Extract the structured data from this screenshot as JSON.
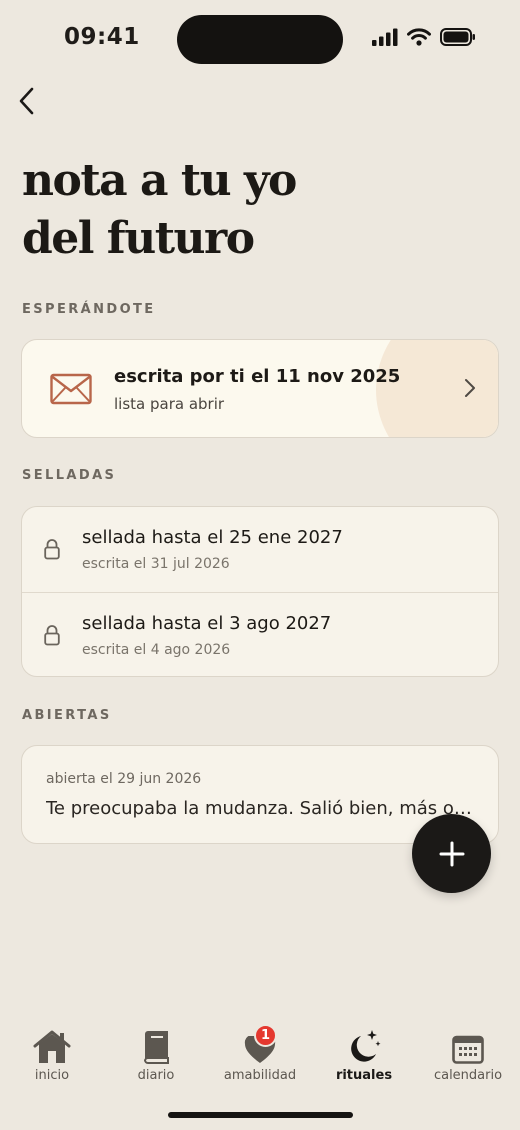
{
  "status_bar": {
    "time": "09:41"
  },
  "page": {
    "title_line1": "nota a tu yo",
    "title_line2": "del futuro"
  },
  "sections": {
    "waiting": {
      "label": "ESPERÁNDOTE",
      "card": {
        "title": "escrita por ti el 11 nov 2025",
        "subtitle": "lista para abrir"
      }
    },
    "sealed": {
      "label": "SELLADAS",
      "items": [
        {
          "title": "sellada hasta el 25 ene 2027",
          "subtitle": "escrita el 31 jul 2026"
        },
        {
          "title": "sellada hasta el 3 ago 2027",
          "subtitle": "escrita el 4 ago 2026"
        }
      ]
    },
    "opened": {
      "label": "ABIERTAS",
      "items": [
        {
          "date": "abierta el 29 jun 2026",
          "text": "Te preocupaba la mudanza. Salió bien, más o menos como esperabas."
        }
      ]
    }
  },
  "tabbar": {
    "items": [
      {
        "label": "inicio",
        "icon": "house-icon"
      },
      {
        "label": "diario",
        "icon": "book-icon"
      },
      {
        "label": "amabilidad",
        "icon": "heart-icon",
        "badge": "1"
      },
      {
        "label": "rituales",
        "icon": "moon-stars-icon",
        "active": true
      },
      {
        "label": "calendario",
        "icon": "calendar-icon"
      }
    ]
  },
  "colors": {
    "background": "#ede8df",
    "card": "#f7f3ea",
    "accent_envelope": "#b8664a",
    "badge": "#e5382f",
    "fab": "#1b1917"
  }
}
